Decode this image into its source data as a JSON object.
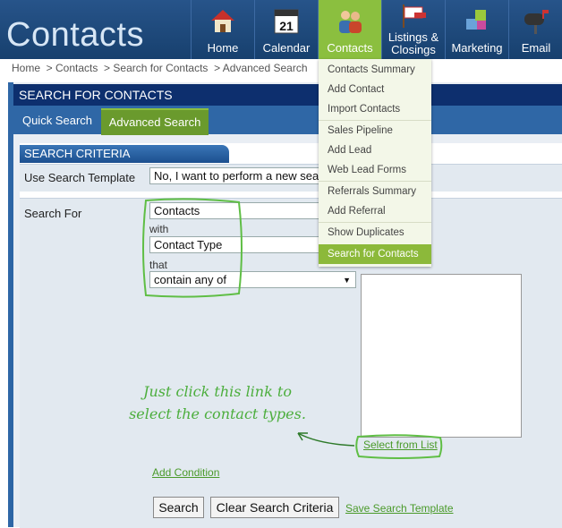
{
  "app": {
    "brand": "Contacts"
  },
  "nav": [
    {
      "label": "Home",
      "icon": "house-icon"
    },
    {
      "label": "Calendar",
      "icon": "calendar-icon"
    },
    {
      "label": "Contacts",
      "icon": "people-icon"
    },
    {
      "label": "Listings &\nClosings",
      "icon": "sold-sign-icon"
    },
    {
      "label": "Marketing",
      "icon": "puzzle-icon"
    },
    {
      "label": "Email",
      "icon": "mailbox-icon"
    }
  ],
  "calendar_day": "21",
  "breadcrumb": "Home  > Contacts  > Search for Contacts  > Advanced Search",
  "page_title": "SEARCH FOR CONTACTS",
  "tabs": {
    "quick": "Quick Search",
    "advanced": "Advanced Search"
  },
  "criteria": {
    "heading": "SEARCH CRITERIA",
    "template_label": "Use Search Template",
    "template_value": "No, I want to perform a new search",
    "search_for_label": "Search For",
    "search_for_value": "Contacts",
    "with_label": "with",
    "field_value": "Contact Type",
    "that_label": "that",
    "operator_value": "contain any of",
    "select_from_list": "Select from List",
    "add_condition": "Add Condition"
  },
  "buttons": {
    "search": "Search",
    "clear": "Clear Search Criteria",
    "save_template": "Save Search Template"
  },
  "menu": {
    "items": [
      "Contacts Summary",
      "Add Contact",
      "Import Contacts",
      "Sales Pipeline",
      "Add Lead",
      "Web Lead Forms",
      "Referrals Summary",
      "Add Referral",
      "Show Duplicates",
      "Search for Contacts"
    ],
    "active": "Search for Contacts"
  },
  "annotation": "Just click this link to select the contact types.",
  "colors": {
    "header": "#1e4a7f",
    "accent_green": "#8bbf3f",
    "annotation_green": "#4cae3d"
  }
}
